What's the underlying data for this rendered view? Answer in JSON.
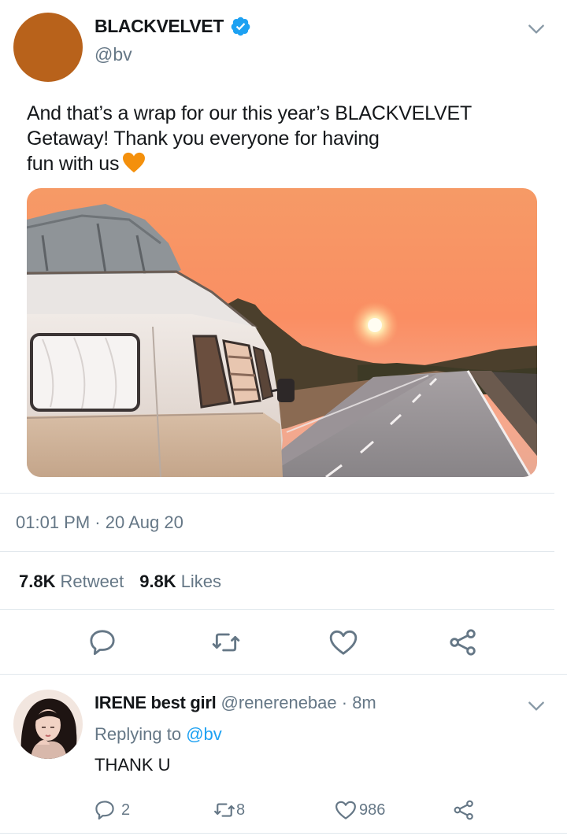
{
  "tweet": {
    "display_name": "BLACKVELVET",
    "handle": "@bv",
    "text_lines": [
      "And that’s a wrap for our this year’s BLACKVELVET",
      "Getaway! Thank you everyone for having",
      "fun with us"
    ],
    "emoji": "orange-heart",
    "timestamp": "01:01 PM · 20 Aug 20",
    "retweet_count": "7.8K",
    "retweet_label": "Retweet",
    "like_count": "9.8K",
    "like_label": "Likes",
    "avatar_color": "#b8621b"
  },
  "reply": {
    "name": "IRENE best girl",
    "meta": " @renerenebae · 8m",
    "replying_prefix": "Replying to ",
    "replying_to": "@bv",
    "text": "THANK U",
    "reply_count": "2",
    "retweet_count": "8",
    "like_count": "986"
  },
  "colors": {
    "text": "#14171a",
    "secondary": "#657786",
    "accent": "#1da1f2",
    "divider": "#e1e8ed"
  }
}
